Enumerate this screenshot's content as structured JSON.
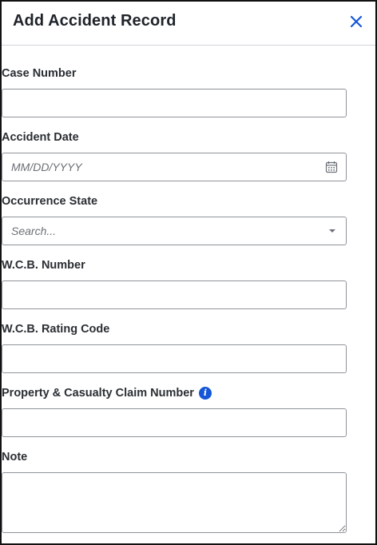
{
  "dialog": {
    "title": "Add Accident Record",
    "close_icon": "close-icon"
  },
  "fields": {
    "case_number": {
      "label": "Case Number",
      "value": ""
    },
    "accident_date": {
      "label": "Accident Date",
      "placeholder": "MM/DD/YYYY",
      "icon": "calendar-icon"
    },
    "occurrence_state": {
      "label": "Occurrence State",
      "placeholder": "Search...",
      "icon": "caret-down-icon"
    },
    "wcb_number": {
      "label": "W.C.B. Number",
      "value": ""
    },
    "wcb_rating_code": {
      "label": "W.C.B. Rating Code",
      "value": ""
    },
    "pc_claim_number": {
      "label": "Property & Casualty Claim Number",
      "value": "",
      "info_icon": "info-icon"
    },
    "note": {
      "label": "Note",
      "value": ""
    }
  },
  "colors": {
    "accent": "#1557d6",
    "border": "#8e9399"
  }
}
